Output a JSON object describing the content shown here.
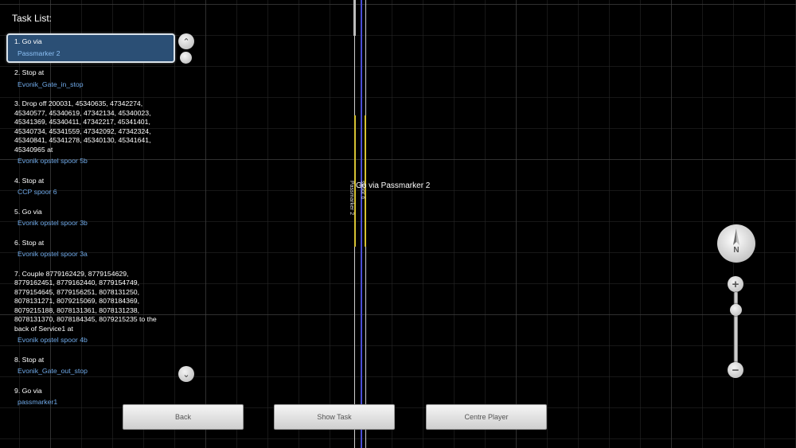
{
  "map": {
    "route_label": "Go via Passmarker 2",
    "vertical_label_1": "Passmarker 2",
    "vertical_label_2": "spoor 6",
    "colors": {
      "rail": "#d8d8d8",
      "route": "#4a4fd8",
      "highlight": "#d6c233"
    }
  },
  "task_list": {
    "title": "Task List:",
    "items": [
      {
        "text": "1. Go via",
        "location": "Passmarker 2",
        "selected": true
      },
      {
        "text": "2. Stop at",
        "location": "Evonik_Gate_in_stop"
      },
      {
        "text": "3. Drop off 200031, 45340635, 47342274, 45340577, 45340619, 47342134, 45340023, 45341369, 45340411, 47342217, 45341401, 45340734, 45341559, 47342092, 47342324, 45340841, 45341278, 45340130, 45341641, 45340965 at",
        "location": "Evonik opstel spoor 5b"
      },
      {
        "text": "4. Stop at",
        "location": "CCP spoor 6"
      },
      {
        "text": "5. Go via",
        "location": "Evonik opstel spoor 3b"
      },
      {
        "text": "6. Stop at",
        "location": "Evonik opstel spoor 3a"
      },
      {
        "text": "7. Couple 8779162429, 8779154629, 8779162451, 8779162440, 8779154749, 8779154645, 8779156251, 8078131250, 8078131271, 8079215069, 8078184369, 8079215188, 8078131361, 8078131238, 8078131370, 8078184345, 8079215235 to the back of Service1 at",
        "location": "Evonik opstel spoor 4b"
      },
      {
        "text": "8. Stop at",
        "location": "Evonik_Gate_out_stop"
      },
      {
        "text": "9. Go via",
        "location": "passmarker1"
      }
    ]
  },
  "buttons": {
    "back": "Back",
    "show_task": "Show Task",
    "centre_player": "Centre Player"
  },
  "compass": {
    "letter": "N"
  },
  "icons": {
    "scroll_up": "chevron-up-icon",
    "scroll_down": "chevron-down-icon",
    "zoom_in": "plus-icon",
    "zoom_out": "minus-icon"
  }
}
